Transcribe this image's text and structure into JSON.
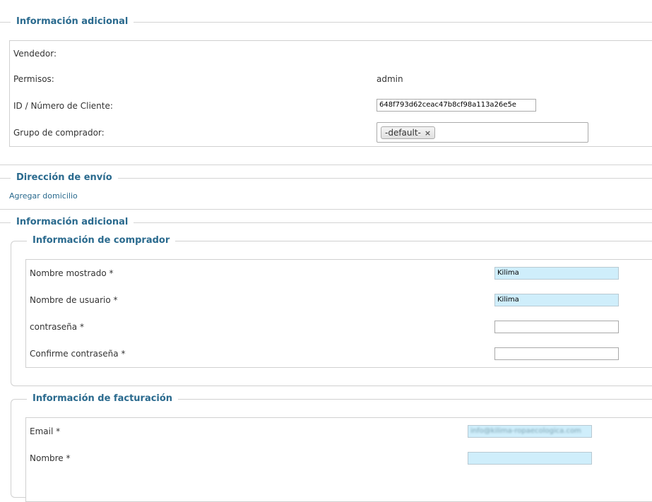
{
  "section_info_adicional_top": {
    "title": "Información adicional",
    "vendedor_label": "Vendedor:",
    "permisos_label": "Permisos:",
    "permisos_value": "admin",
    "id_label": "ID / Número de Cliente:",
    "id_value": "648f793d62ceac47b8cf98a113a26e5e",
    "grupo_label": "Grupo de comprador:",
    "grupo_tag": "-default-",
    "tag_remove": "×"
  },
  "section_direccion_envio": {
    "title": "Dirección de envío",
    "add_link": "Agregar domicilio"
  },
  "section_info_adicional_bottom": {
    "title": "Información adicional"
  },
  "comprador": {
    "title": "Información de comprador",
    "nombre_mostrado_label": "Nombre mostrado *",
    "nombre_mostrado_value": "Kilima",
    "nombre_usuario_label": "Nombre de usuario *",
    "nombre_usuario_value": "Kilima",
    "contrasena_label": "contraseña *",
    "confirme_label": "Confirme contraseña *"
  },
  "facturacion": {
    "title": "Información de facturación",
    "email_label": "Email *",
    "email_value": "info@kilima-ropaecologica.com",
    "nombre_label": "Nombre *"
  }
}
